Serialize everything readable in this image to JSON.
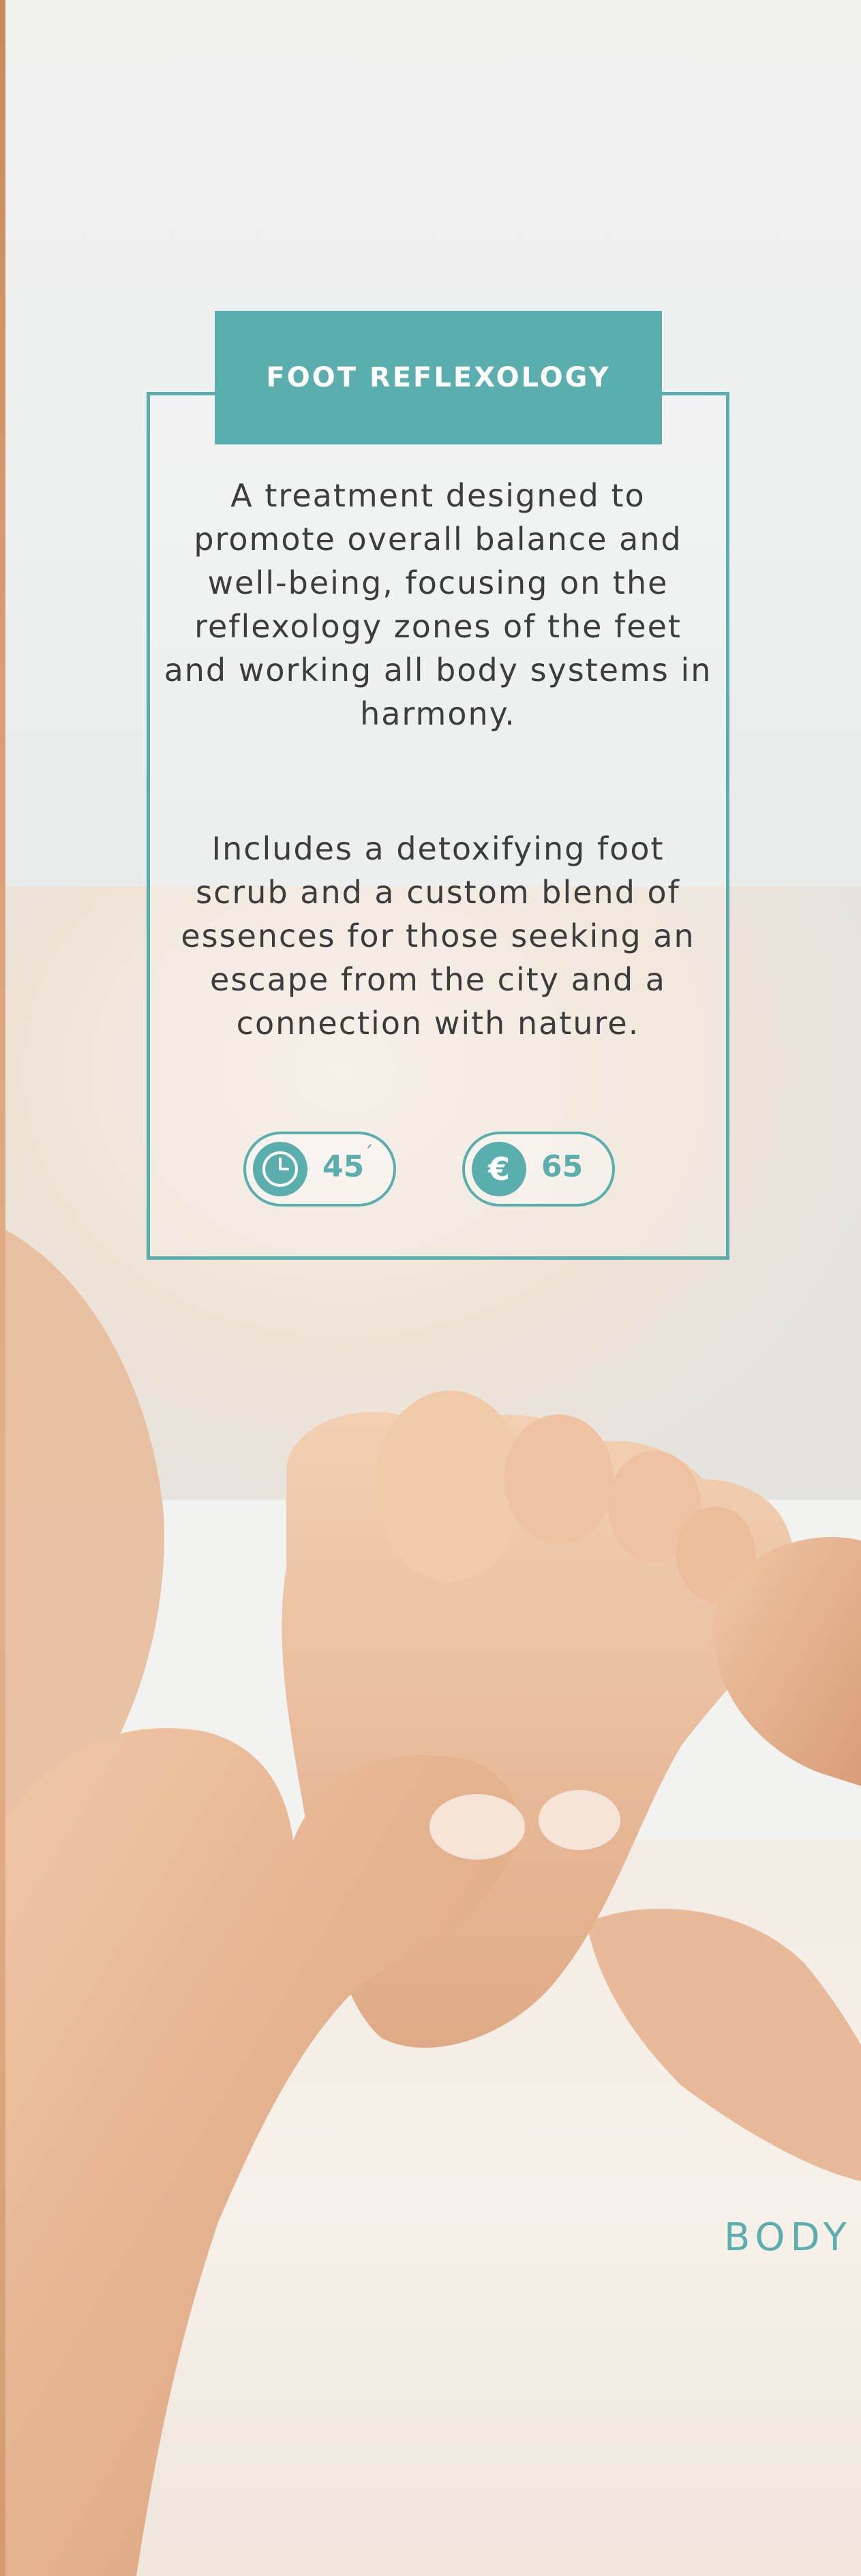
{
  "treatment": {
    "title": "FOOT REFLEXOLOGY",
    "description_1": "A treatment designed to promote overall balance and well-being, focusing on the reflexology zones of the feet and working all body systems in harmony.",
    "description_2": "Includes a detoxifying foot scrub and a custom blend of essences for those seeking an escape from the city and a connection with nature.",
    "duration": {
      "icon": "clock-icon",
      "value": "45",
      "unit": "´"
    },
    "price": {
      "icon": "euro-icon",
      "symbol": "€",
      "value": "65"
    }
  },
  "section_label": "BODY",
  "colors": {
    "accent": "#5aaeae",
    "text": "#3c3c3c"
  }
}
